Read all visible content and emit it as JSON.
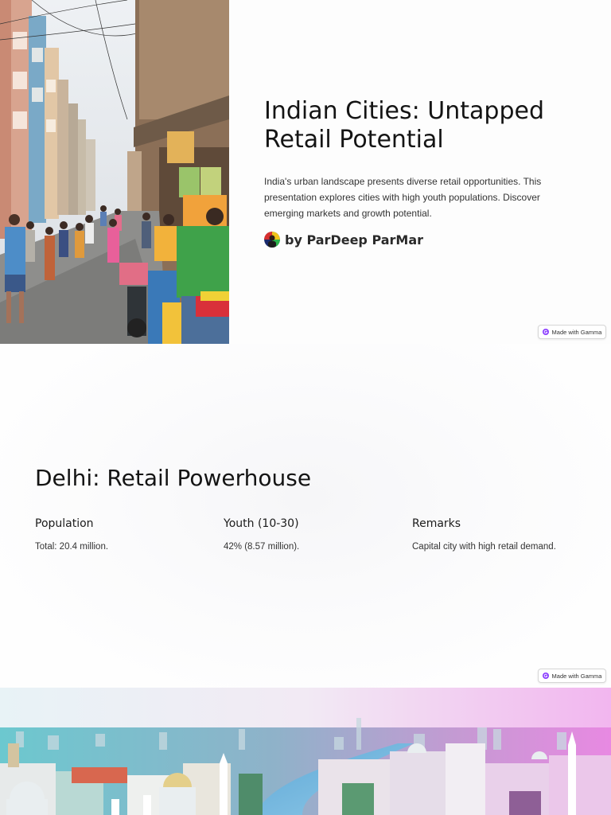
{
  "slides": [
    {
      "title": "Indian Cities: Untapped Retail Potential",
      "description": "India's urban landscape presents diverse retail opportunities. This presentation explores cities with high youth populations. Discover emerging markets and growth potential.",
      "author": "by ParDeep ParMar",
      "badge": "Made with Gamma"
    },
    {
      "title": "Delhi: Retail Powerhouse",
      "columns": [
        {
          "heading": "Population",
          "text": "Total: 20.4 million."
        },
        {
          "heading": "Youth (10-30)",
          "text": "42% (8.57 million)."
        },
        {
          "heading": "Remarks",
          "text": "Capital city with high retail demand."
        }
      ],
      "badge": "Made with Gamma"
    }
  ],
  "colors": {
    "gamma_accent": "#8b3dff",
    "skyline_gradient_left": "#7fe0e6",
    "skyline_gradient_right": "#f09be8"
  }
}
